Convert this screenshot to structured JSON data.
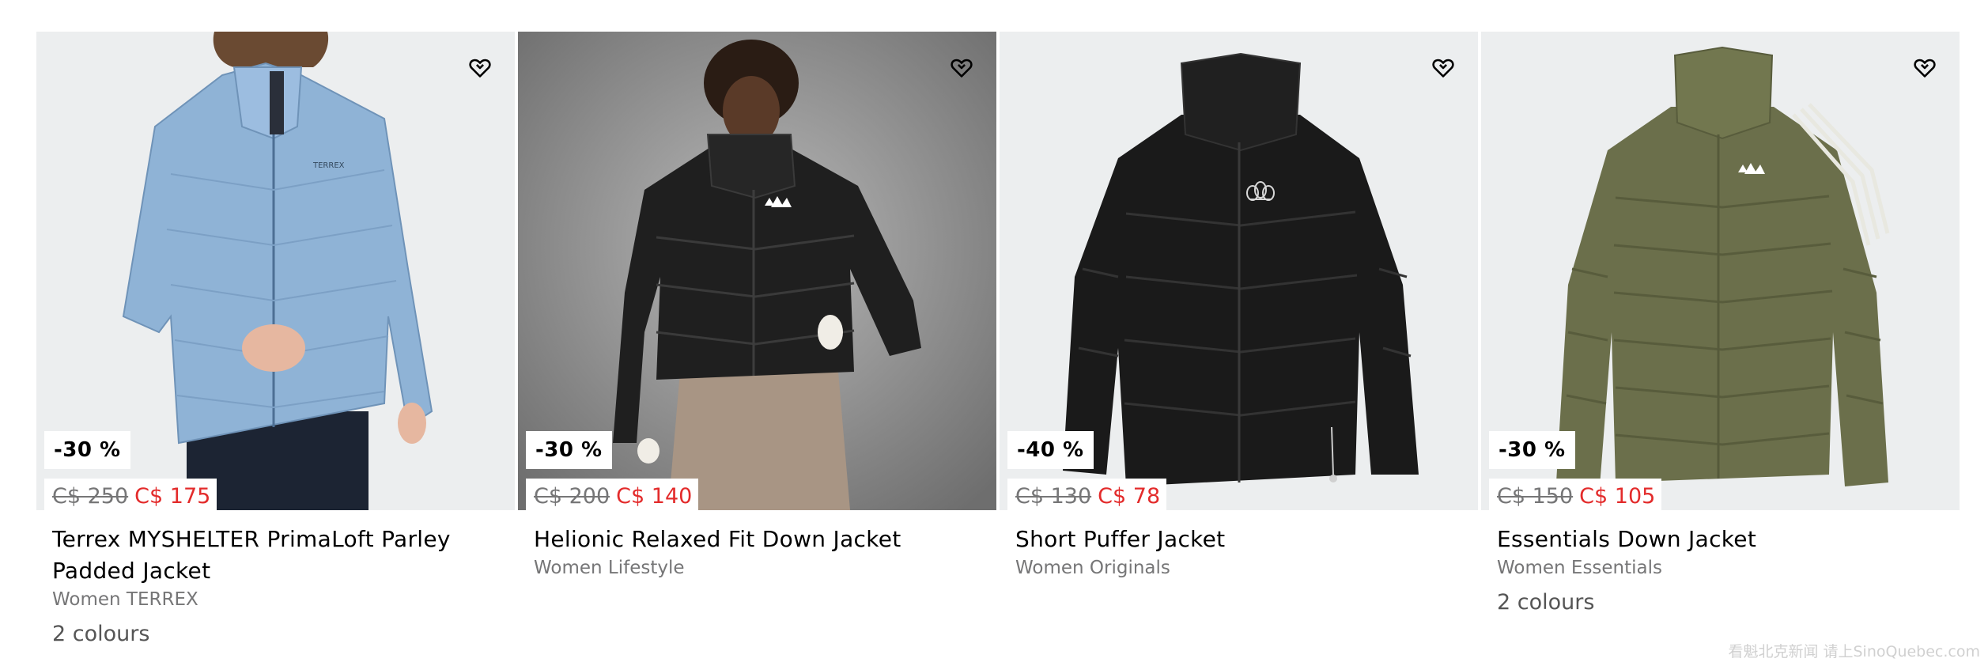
{
  "products": [
    {
      "discount": "-30 %",
      "old_price": "C$ 250",
      "new_price": "C$ 175",
      "title": "Terrex MYSHELTER PrimaLoft Parley Padded Jacket",
      "subtitle": "Women TERREX",
      "colours": "2 colours",
      "icon": "heart-icon"
    },
    {
      "discount": "-30 %",
      "old_price": "C$ 200",
      "new_price": "C$ 140",
      "title": "Helionic Relaxed Fit Down Jacket",
      "subtitle": "Women Lifestyle",
      "colours": "",
      "icon": "heart-icon"
    },
    {
      "discount": "-40 %",
      "old_price": "C$ 130",
      "new_price": "C$ 78",
      "title": "Short Puffer Jacket",
      "subtitle": "Women Originals",
      "colours": "",
      "icon": "heart-icon"
    },
    {
      "discount": "-30 %",
      "old_price": "C$ 150",
      "new_price": "C$ 105",
      "title": "Essentials Down Jacket",
      "subtitle": "Women Essentials",
      "colours": "2 colours",
      "icon": "heart-icon"
    }
  ],
  "watermark": "看魁北克新闻 请上SinoQuebec.com",
  "colors": {
    "sale_price": "#e32b2b",
    "muted_text": "#767677",
    "tile_background": "#eceeef"
  }
}
